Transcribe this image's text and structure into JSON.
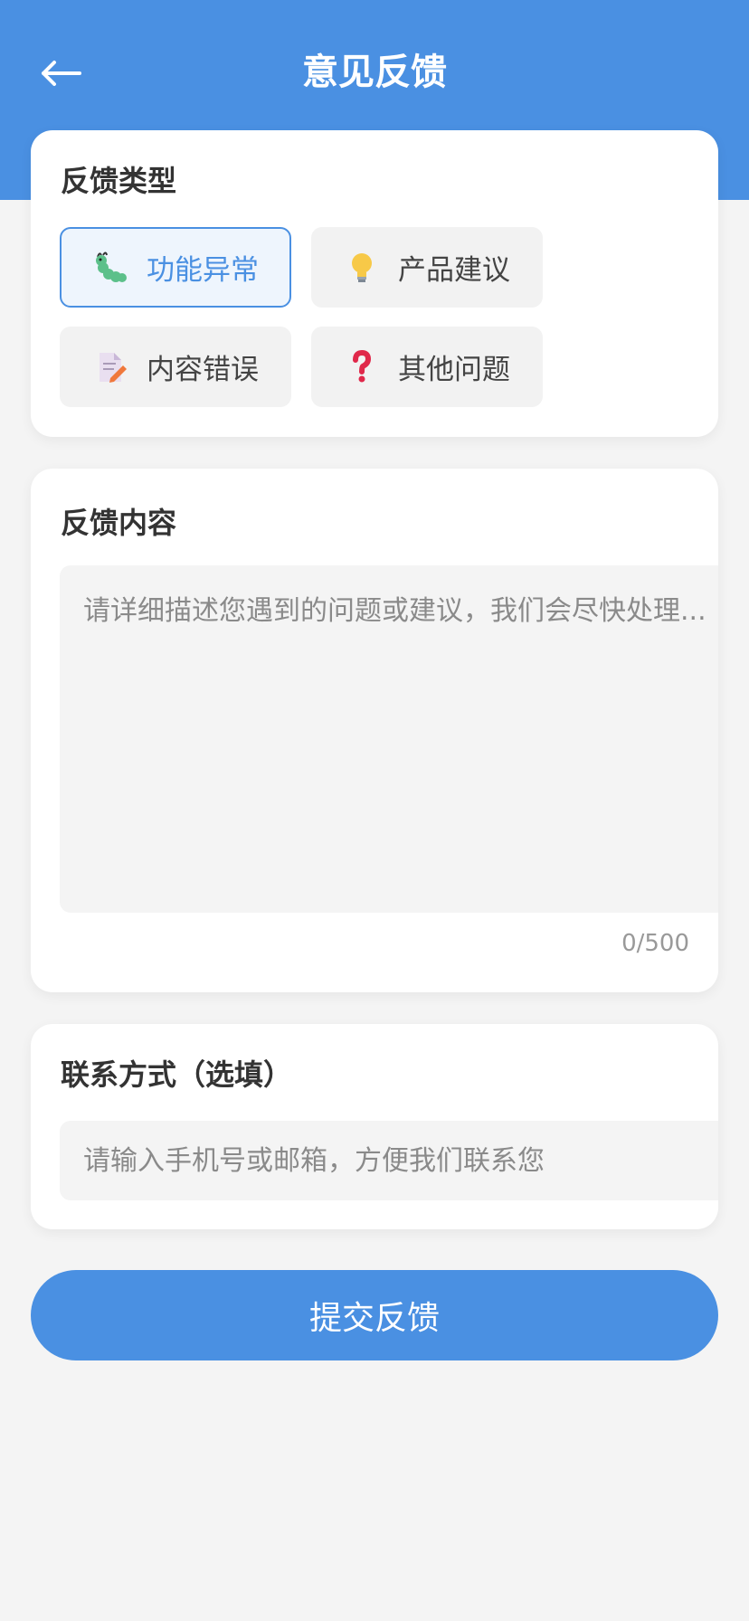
{
  "header": {
    "title": "意见反馈",
    "back_icon": "arrow-left-icon"
  },
  "feedback_type": {
    "title": "反馈类型",
    "options": [
      {
        "label": "功能异常",
        "icon": "bug-icon",
        "selected": true
      },
      {
        "label": "产品建议",
        "icon": "lightbulb-icon",
        "selected": false
      },
      {
        "label": "内容错误",
        "icon": "document-edit-icon",
        "selected": false
      },
      {
        "label": "其他问题",
        "icon": "question-mark-icon",
        "selected": false
      }
    ]
  },
  "feedback_content": {
    "title": "反馈内容",
    "placeholder": "请详细描述您遇到的问题或建议，我们会尽快处理...",
    "value": "",
    "counter": "0/500"
  },
  "contact": {
    "title": "联系方式（选填）",
    "placeholder": "请输入手机号或邮箱，方便我们联系您",
    "value": ""
  },
  "submit": {
    "label": "提交反馈"
  },
  "colors": {
    "primary": "#4a90e2",
    "background": "#f4f4f4",
    "card": "#ffffff"
  }
}
